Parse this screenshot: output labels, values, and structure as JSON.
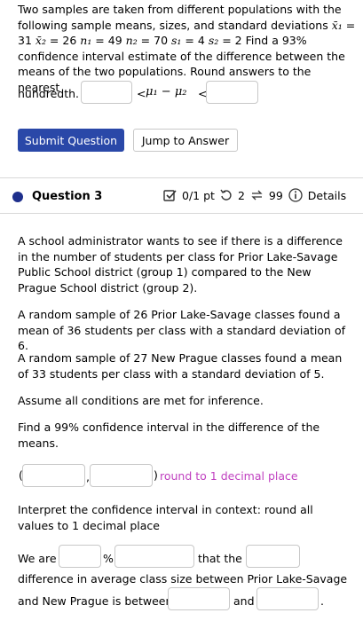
{
  "q_prev": {
    "text_line1": "Two samples are taken from different populations with the",
    "text_line2": "following sample means, sizes, and standard deviations",
    "math": {
      "x1_sym": "x̄₁",
      "x1_val": "31",
      "x2_sym": "x̄₂",
      "x2_val": "26",
      "n1_sym": "n₁",
      "n1_val": "49",
      "n2_sym": "n₂",
      "n2_val": "70",
      "s1_sym": "s₁",
      "s1_val": "4",
      "s2_sym": "s₂",
      "s2_val": "2"
    },
    "find_text": "Find a 93%",
    "text_line4": "confidence interval estimate of the difference between the",
    "text_line5": "means of the two populations. Round answers to the nearest",
    "hundredth": "hundredth.",
    "lt": "<",
    "mu_expr": "μ₁ − μ₂",
    "lower_value": "",
    "upper_value": ""
  },
  "buttons": {
    "submit": "Submit Question",
    "jump": "Jump to Answer"
  },
  "header": {
    "title": "Question 3",
    "points": "0/1 pt",
    "retries": "2",
    "attempts": "99",
    "details": "Details"
  },
  "q3": {
    "p1": "A school administrator wants to see if there is a difference in the number of students per class for Prior Lake-Savage Public School district (group 1) compared to the New Prague School district (group 2).",
    "p2": "A random sample of 26 Prior Lake-Savage classes found a mean of 36 students per class with a standard deviation of 6.",
    "p3": "A random sample of 27 New Prague classes found a mean of 33 students per class with a standard deviation of 5.",
    "p4": "Assume all conditions are met for inference.",
    "p5": "Find a 99% confidence interval in the difference of the means.",
    "open_paren": "(",
    "comma": ",",
    "close_paren": ")",
    "round_hint": "round to 1 decimal place",
    "p6": "Interpret the confidence interval in context: round all values to 1 decimal place",
    "we_are": "We are",
    "percent": "%",
    "that_the": "that the",
    "diff_text": "difference in average class size between Prior Lake-Savage",
    "and_between": "and New Prague is between",
    "and": "and",
    "period": "."
  },
  "colors": {
    "accent": "#2a48a8",
    "hint": "#c040c0",
    "bullet": "#1e2f8c"
  }
}
